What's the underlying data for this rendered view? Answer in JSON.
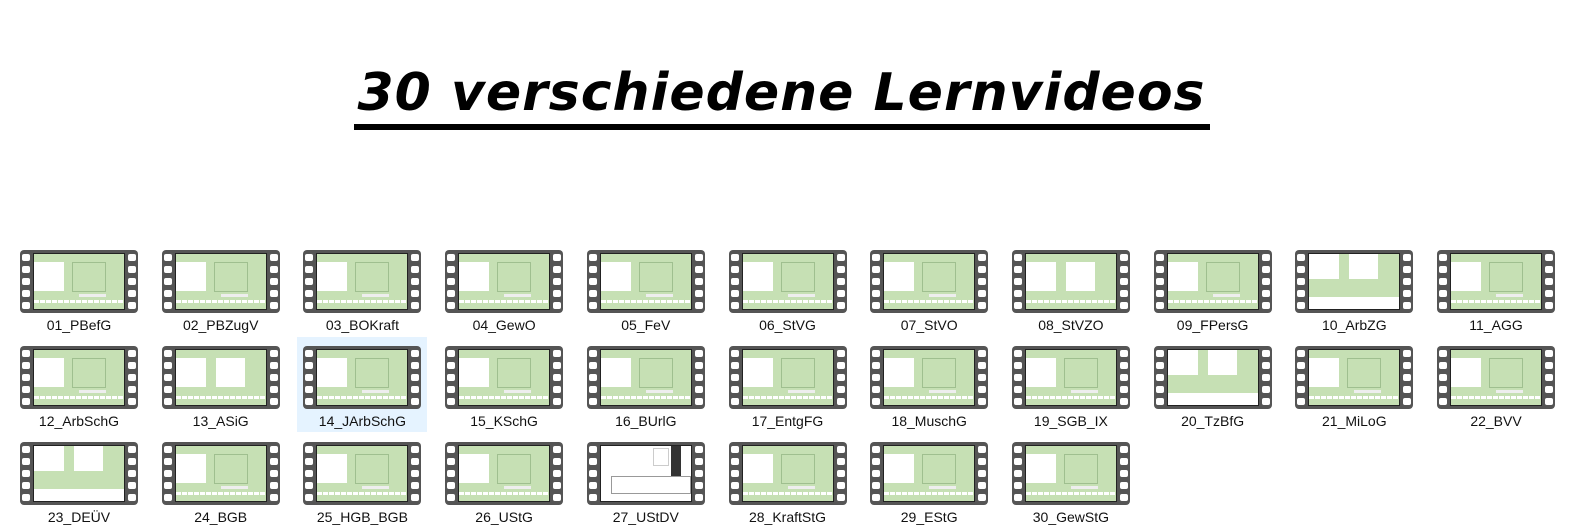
{
  "title": "30 verschiedene Lernvideos",
  "selected_index": 13,
  "colors": {
    "slide_bg": "#c6e0b4",
    "film": "#555555",
    "selection": "#e5f3ff"
  },
  "icon": "video-film-thumbnail-icon",
  "videos": [
    {
      "name": "01_PBefG"
    },
    {
      "name": "02_PBZugV"
    },
    {
      "name": "03_BOKraft"
    },
    {
      "name": "04_GewO"
    },
    {
      "name": "05_FeV"
    },
    {
      "name": "06_StVG"
    },
    {
      "name": "07_StVO"
    },
    {
      "name": "08_StVZO"
    },
    {
      "name": "09_FPersG"
    },
    {
      "name": "10_ArbZG"
    },
    {
      "name": "11_AGG"
    },
    {
      "name": "12_ArbSchG"
    },
    {
      "name": "13_ASiG"
    },
    {
      "name": "14_JArbSchG"
    },
    {
      "name": "15_KSchG"
    },
    {
      "name": "16_BUrlG"
    },
    {
      "name": "17_EntgFG"
    },
    {
      "name": "18_MuschG"
    },
    {
      "name": "19_SGB_IX"
    },
    {
      "name": "20_TzBfG"
    },
    {
      "name": "21_MiLoG"
    },
    {
      "name": "22_BVV"
    },
    {
      "name": "23_DEÜV"
    },
    {
      "name": "24_BGB"
    },
    {
      "name": "25_HGB_BGB"
    },
    {
      "name": "26_UStG"
    },
    {
      "name": "27_UStDV"
    },
    {
      "name": "28_KraftStG"
    },
    {
      "name": "29_EStG"
    },
    {
      "name": "30_GewStG"
    }
  ]
}
